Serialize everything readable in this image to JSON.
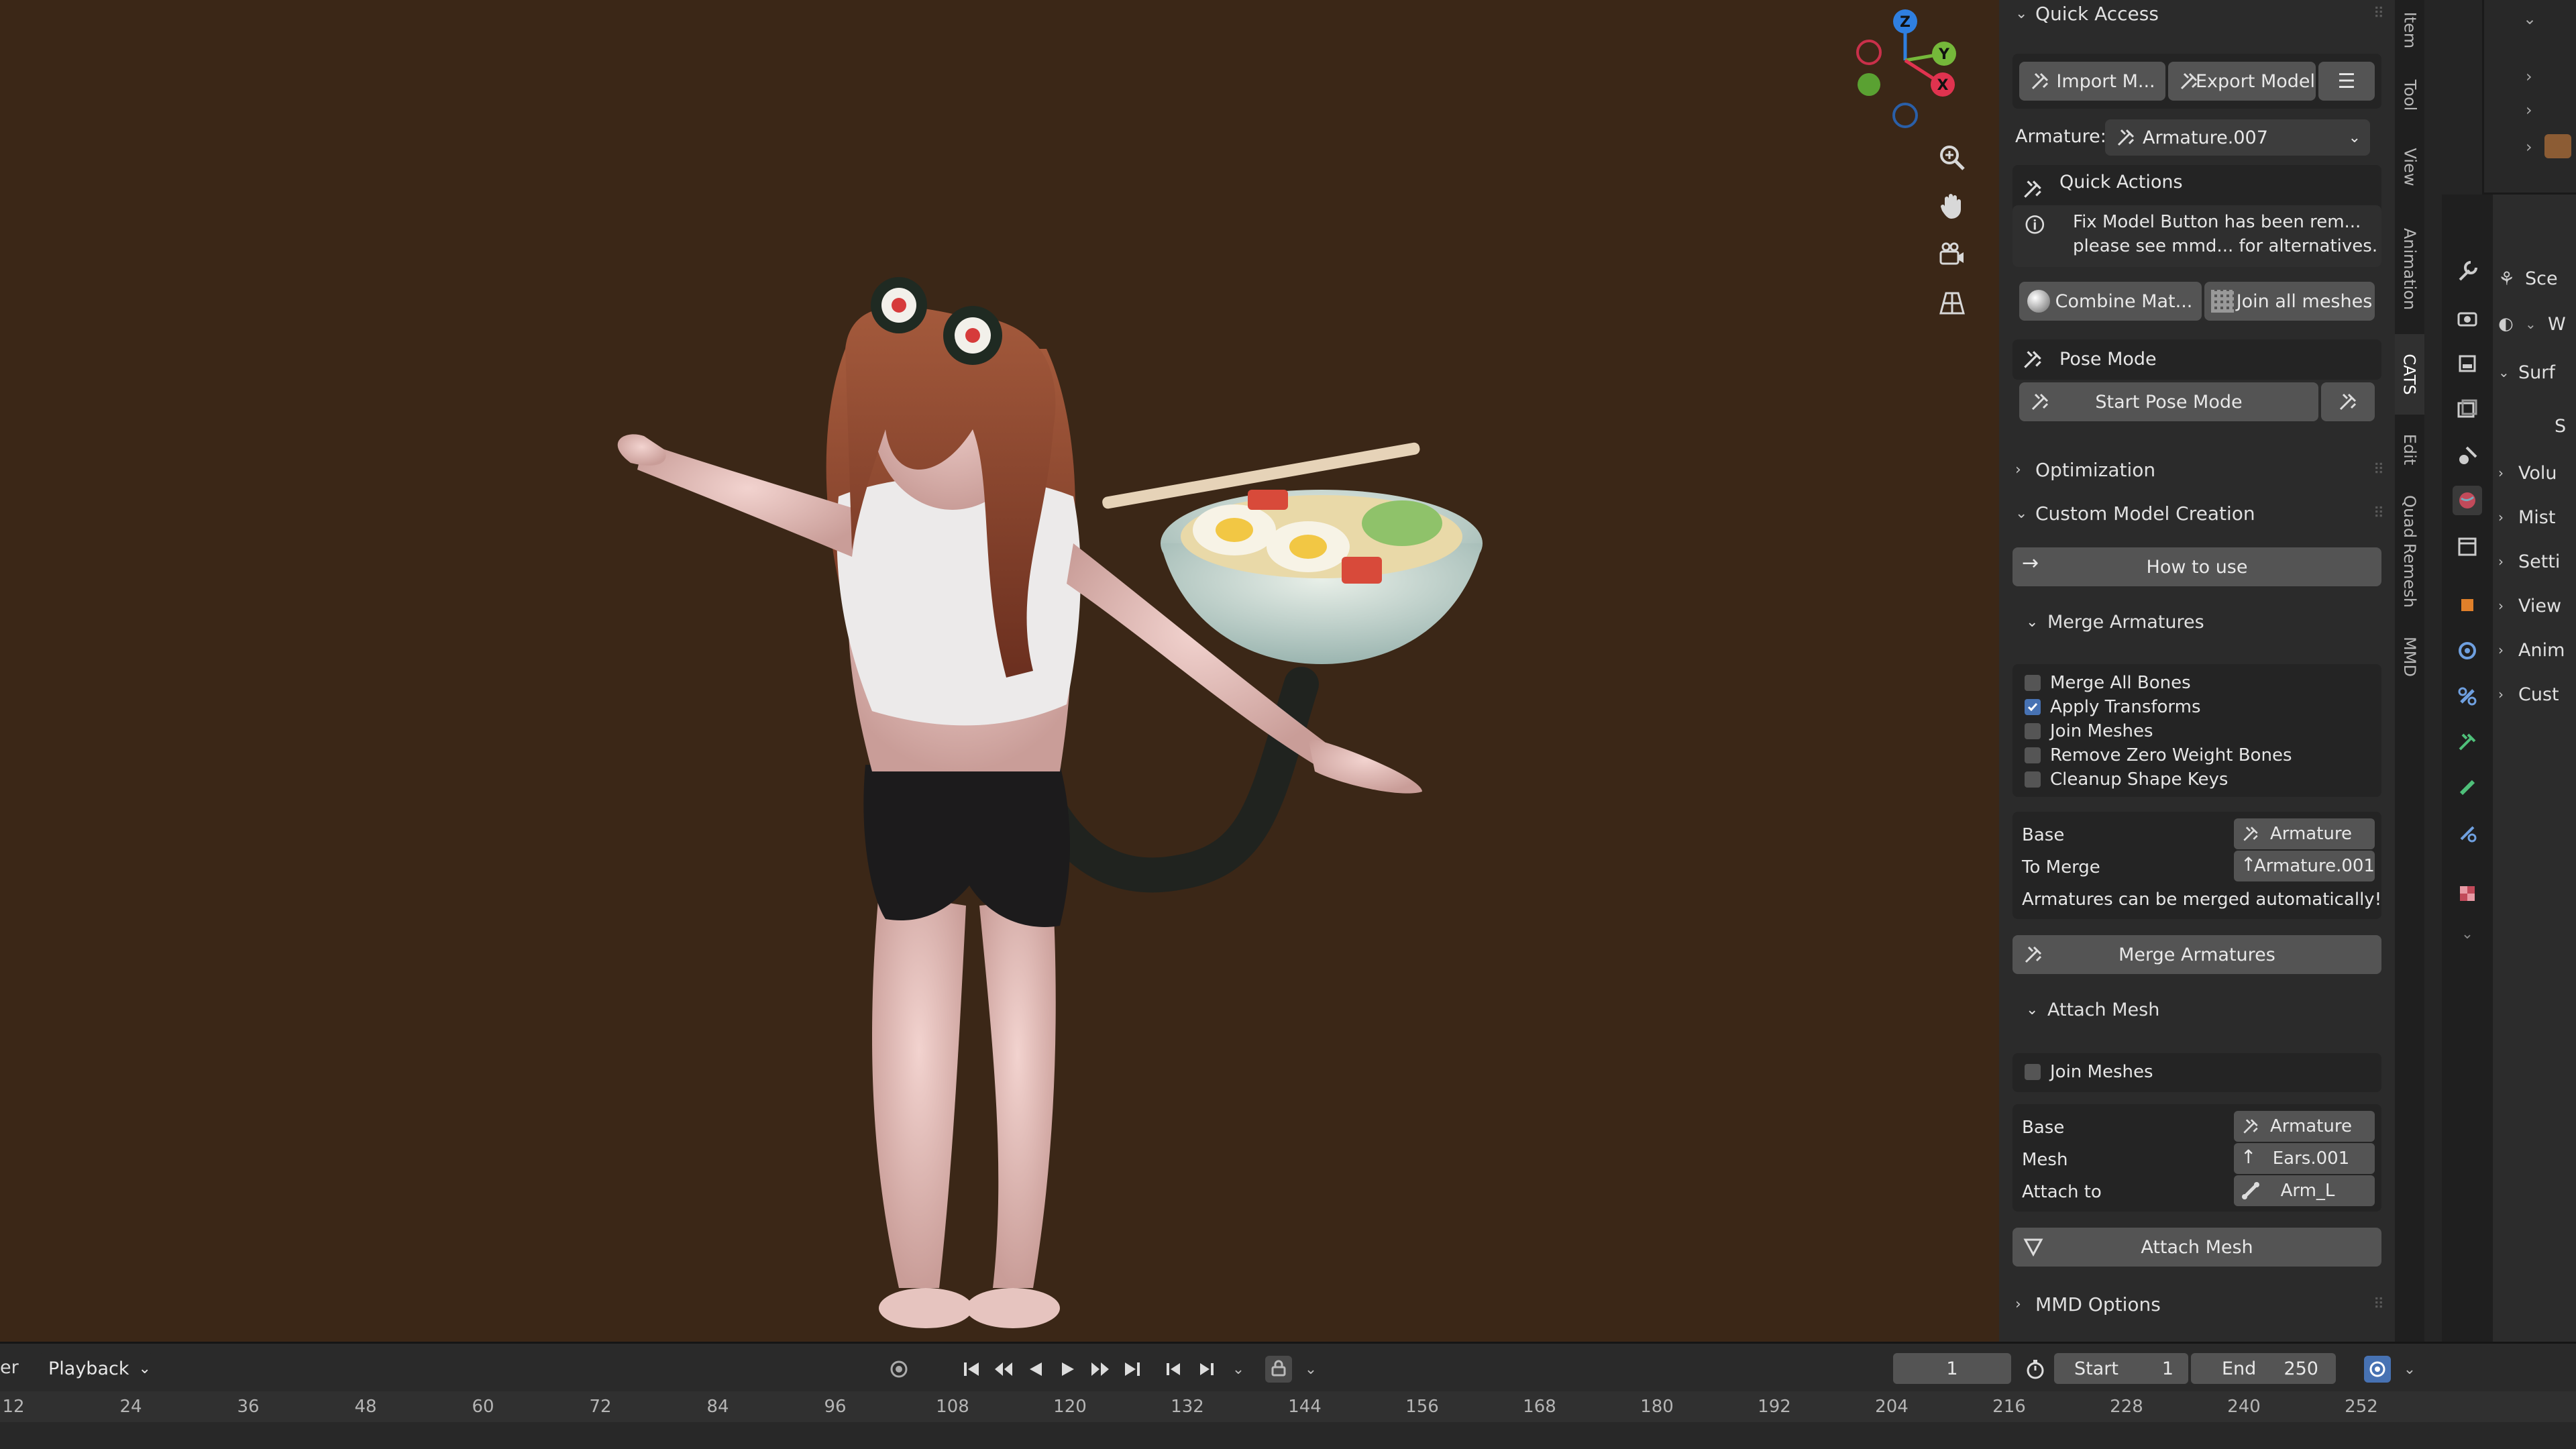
{
  "panel": {
    "quick_access": "Quick Access",
    "import_model": "Import M...",
    "export_model": "Export Model",
    "armature_label": "Armature:",
    "armature_value": "Armature.007",
    "quick_actions": "Quick Actions",
    "fix_model_notice_1": "Fix Model Button has been rem...",
    "fix_model_notice_2": "please see mmd... for alternatives.",
    "combine_materials": "Combine Mat...",
    "join_all_meshes": "Join all meshes",
    "pose_mode": "Pose Mode",
    "start_pose_mode": "Start Pose Mode",
    "optimization": "Optimization",
    "custom_model_creation": "Custom Model Creation",
    "how_to_use": "How to use",
    "merge_armatures_header": "Merge Armatures",
    "checkboxes": [
      {
        "label": "Merge All Bones",
        "checked": false
      },
      {
        "label": "Apply Transforms",
        "checked": true
      },
      {
        "label": "Join Meshes",
        "checked": false
      },
      {
        "label": "Remove Zero Weight Bones",
        "checked": false
      },
      {
        "label": "Cleanup Shape Keys",
        "checked": false
      }
    ],
    "base_label": "Base",
    "base_value": "Armature",
    "to_merge_label": "To Merge",
    "to_merge_value": "Armature.001",
    "merge_note": "Armatures can be merged automatically!",
    "merge_armatures_button": "Merge Armatures",
    "attach_mesh_header": "Attach Mesh",
    "attach_join_meshes": "Join Meshes",
    "attach_base_label": "Base",
    "attach_base_value": "Armature",
    "mesh_label": "Mesh",
    "mesh_value": "Ears.001",
    "attach_to_label": "Attach to",
    "attach_to_value": "Arm_L",
    "attach_mesh_button": "Attach Mesh",
    "mmd_options": "MMD Options"
  },
  "tabs": [
    "Item",
    "Tool",
    "View",
    "Animation",
    "CATS",
    "Edit",
    "Quad Remesh",
    "MMD"
  ],
  "right_editor": {
    "scene_label": "Sce",
    "world_label": "W",
    "rows": [
      "Surf",
      "S",
      "Volu",
      "Mist",
      "Setti",
      "View",
      "Anim",
      "Cust"
    ]
  },
  "timeline": {
    "editor_label": "er",
    "playback": "Playback",
    "current_frame": "1",
    "start_label": "Start",
    "start_value": "1",
    "end_label": "End",
    "end_value": "250",
    "ticks": [
      "12",
      "24",
      "36",
      "48",
      "60",
      "72",
      "84",
      "96",
      "108",
      "120",
      "132",
      "144",
      "156",
      "168",
      "180",
      "192",
      "204",
      "216",
      "228",
      "240",
      "252"
    ]
  },
  "gizmo": {
    "z": "Z",
    "y": "Y",
    "x": "X"
  },
  "colors": {
    "viewport_bg": "#3b2717",
    "panel_bg": "#2b2b2b",
    "button_bg": "#545454",
    "accent_blue": "#4772b3",
    "axis_x": "#e0334f",
    "axis_y": "#75b83a",
    "axis_z": "#2f7fe0"
  }
}
